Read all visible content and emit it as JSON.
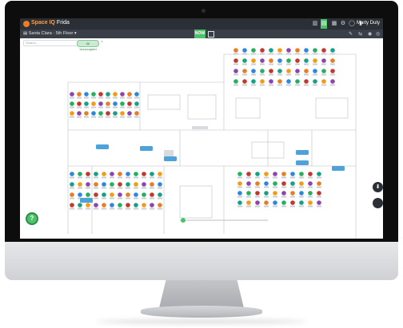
{
  "app": {
    "brand": "Space IQ",
    "module": "Frida",
    "user_name": "Marty Duty"
  },
  "toolbar": {
    "site_selector": "Santa Clara · 5th Floor",
    "now_label": "NOW"
  },
  "search": {
    "placeholder": "Search..."
  },
  "filter": {
    "chip_label": "All Unoccupied"
  },
  "help": {
    "label": "?"
  },
  "colors": {
    "appbar": "#2b2f36",
    "accent": "#4cc36b",
    "brand": "#f27a22",
    "seat_colors": [
      "#8e44ad",
      "#e67e22",
      "#2e86de",
      "#27ae60",
      "#c0392b",
      "#16a085",
      "#f39c12"
    ]
  }
}
